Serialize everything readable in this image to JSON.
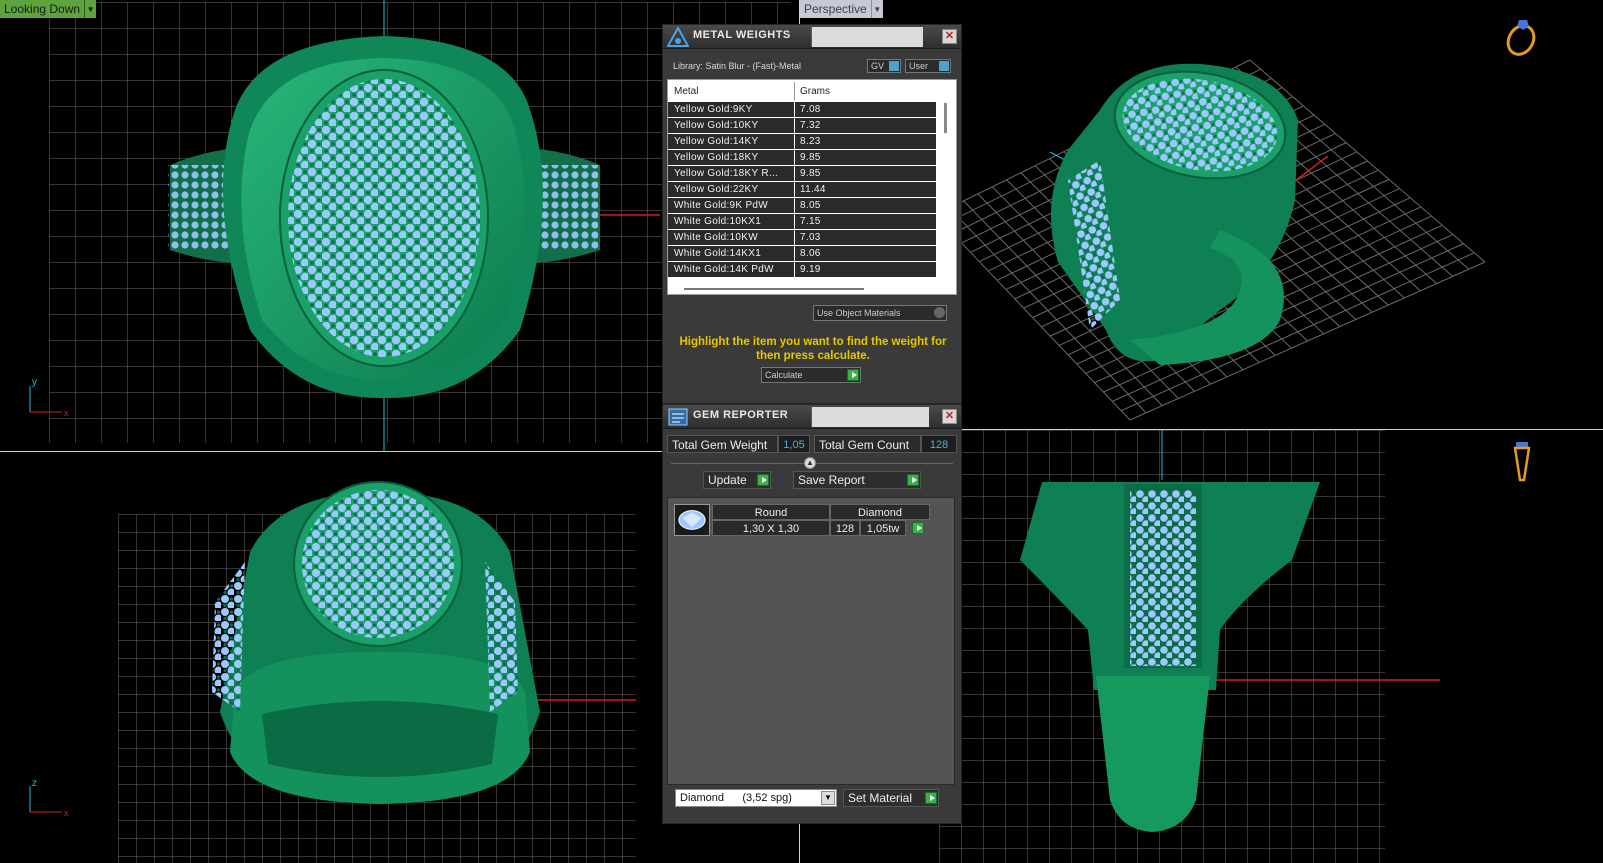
{
  "views": {
    "top_left": {
      "dropdown": "Looking Down"
    },
    "top_right": {
      "dropdown": "Perspective"
    }
  },
  "colors": {
    "ring_green": "#1aa169",
    "gem_blue": "#9cc8ff",
    "grid": "#6a6a6a",
    "axis_red": "#d21f1f",
    "axis_cyan": "#2cb9d8",
    "hint_yellow": "#e6c800"
  },
  "icons": [
    "ring-orientation-icon",
    "ring-side-icon",
    "metal-weights-icon",
    "gem-reporter-icon",
    "close-icon",
    "round-gem-icon"
  ],
  "metal_weights": {
    "title": "METAL WEIGHTS",
    "library": "Library: Satin Blur - (Fast)-Metal",
    "gv_label": "GV",
    "user_label": "User",
    "columns": [
      "Metal",
      "Grams"
    ],
    "rows": [
      {
        "metal": "Yellow Gold:9KY",
        "grams": "7.08"
      },
      {
        "metal": "Yellow Gold:10KY",
        "grams": "7.32"
      },
      {
        "metal": "Yellow Gold:14KY",
        "grams": "8.23"
      },
      {
        "metal": "Yellow Gold:18KY",
        "grams": "9.85"
      },
      {
        "metal": "Yellow Gold:18KY R...",
        "grams": "9.85"
      },
      {
        "metal": "Yellow Gold:22KY",
        "grams": "11.44"
      },
      {
        "metal": "White Gold:9K PdW",
        "grams": "8.05"
      },
      {
        "metal": "White Gold:10KX1",
        "grams": "7.15"
      },
      {
        "metal": "White Gold:10KW",
        "grams": "7.03"
      },
      {
        "metal": "White Gold:14KX1",
        "grams": "8.06"
      },
      {
        "metal": "White Gold:14K PdW",
        "grams": "9.19"
      }
    ],
    "use_object_materials": "Use Object Materials",
    "hint": "Highlight the item you want to find the weight for then press calculate.",
    "calculate": "Calculate"
  },
  "gem_reporter": {
    "title": "GEM REPORTER",
    "total_gem_weight_label": "Total Gem Weight",
    "total_gem_weight": "1,05",
    "total_gem_count_label": "Total Gem Count",
    "total_gem_count": "128",
    "update": "Update",
    "save_report": "Save Report",
    "gems": [
      {
        "shape": "Round",
        "material": "Diamond",
        "size": "1,30 X 1,30",
        "count": "128",
        "weight": "1,05tw"
      }
    ],
    "material_select": "Diamond      (3,52 spg)",
    "set_material": "Set Material"
  }
}
